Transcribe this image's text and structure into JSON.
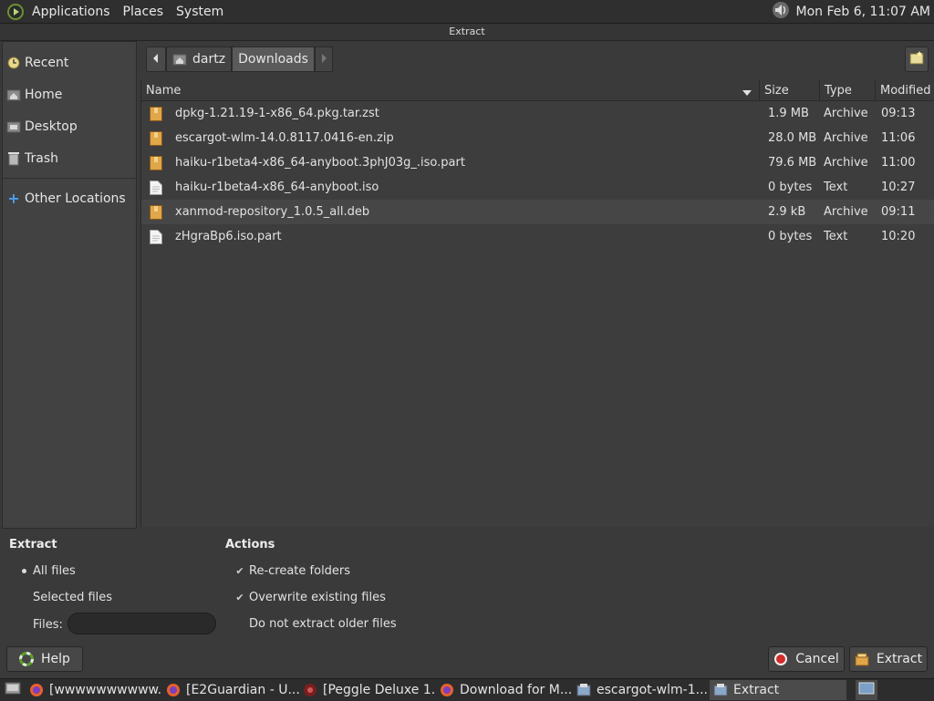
{
  "top_panel": {
    "menus": [
      "Applications",
      "Places",
      "System"
    ],
    "clock": "Mon Feb  6, 11:07 AM"
  },
  "window": {
    "title": "Extract"
  },
  "sidebar": {
    "items": [
      {
        "label": "Recent",
        "icon": "clock-icon"
      },
      {
        "label": "Home",
        "icon": "home-folder-icon"
      },
      {
        "label": "Desktop",
        "icon": "desktop-folder-icon"
      },
      {
        "label": "Trash",
        "icon": "trash-icon"
      }
    ],
    "other": {
      "label": "Other Locations",
      "icon": "plus-icon"
    }
  },
  "path": {
    "crumbs": [
      "dartz",
      "Downloads"
    ]
  },
  "list": {
    "columns": [
      "Name",
      "Size",
      "Type",
      "Modified"
    ],
    "rows": [
      {
        "name": "dpkg-1.21.19-1-x86_64.pkg.tar.zst",
        "size": "1.9 MB",
        "type": "Archive",
        "modified": "09:13",
        "icon": "archive-icon"
      },
      {
        "name": "escargot-wlm-14.0.8117.0416-en.zip",
        "size": "28.0 MB",
        "type": "Archive",
        "modified": "11:06",
        "icon": "archive-icon"
      },
      {
        "name": "haiku-r1beta4-x86_64-anyboot.3phJ03g_.iso.part",
        "size": "79.6 MB",
        "type": "Archive",
        "modified": "11:00",
        "icon": "archive-icon"
      },
      {
        "name": "haiku-r1beta4-x86_64-anyboot.iso",
        "size": "0 bytes",
        "type": "Text",
        "modified": "10:27",
        "icon": "text-file-icon"
      },
      {
        "name": "xanmod-repository_1.0.5_all.deb",
        "size": "2.9 kB",
        "type": "Archive",
        "modified": "09:11",
        "icon": "archive-icon"
      },
      {
        "name": "zHgraBp6.iso.part",
        "size": "0 bytes",
        "type": "Text",
        "modified": "10:20",
        "icon": "text-file-icon"
      }
    ]
  },
  "extract": {
    "title": "Extract",
    "all_files": "All files",
    "selected_files": "Selected files",
    "files_label": "Files:",
    "files_value": "",
    "selected": "All files"
  },
  "actions": {
    "title": "Actions",
    "recreate": {
      "label": "Re-create folders",
      "checked": true
    },
    "overwrite": {
      "label": "Overwrite existing files",
      "checked": true
    },
    "no_older": {
      "label": "Do not extract older files",
      "checked": false
    }
  },
  "buttons": {
    "help": "Help",
    "cancel": "Cancel",
    "extract": "Extract"
  },
  "taskbar": {
    "tasks": [
      {
        "label": "[wwwwwwwwww...",
        "icon": "firefox-icon",
        "active": false
      },
      {
        "label": "[E2Guardian - U...",
        "icon": "firefox-icon",
        "active": false
      },
      {
        "label": "[Peggle Deluxe 1....",
        "icon": "wine-icon",
        "active": false
      },
      {
        "label": "Download for M...",
        "icon": "firefox-icon",
        "active": false
      },
      {
        "label": "escargot-wlm-1...",
        "icon": "archive-manager-icon",
        "active": false
      },
      {
        "label": "Extract",
        "icon": "archive-manager-icon",
        "active": true
      }
    ]
  },
  "colors": {
    "archive_icon": "#e0a64a",
    "record_red": "#d42b2b",
    "help_green": "#5aa02c"
  }
}
